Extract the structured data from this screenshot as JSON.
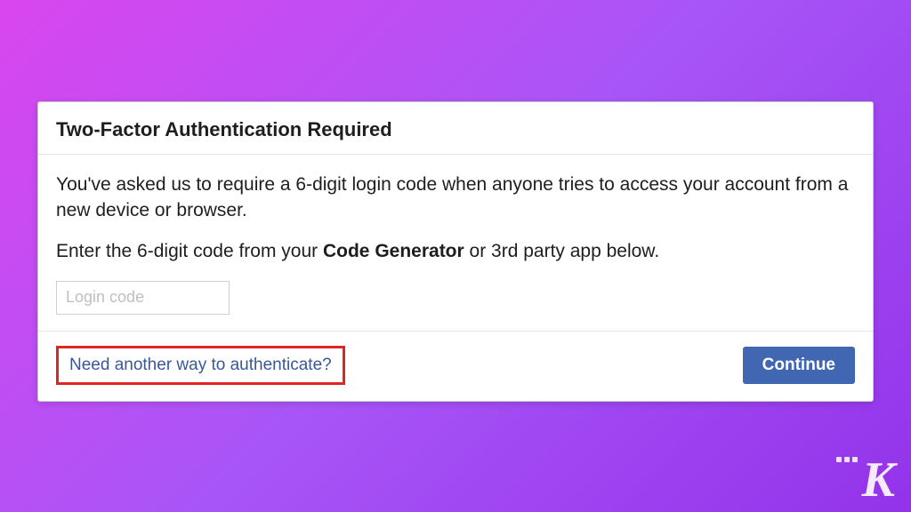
{
  "dialog": {
    "title": "Two-Factor Authentication Required",
    "description1": "You've asked us to require a 6-digit login code when anyone tries to access your account from a new device or browser.",
    "description2_prefix": "Enter the 6-digit code from your ",
    "description2_bold": "Code Generator",
    "description2_suffix": " or 3rd party app below.",
    "input_placeholder": "Login code",
    "alt_link": "Need another way to authenticate?",
    "continue_label": "Continue"
  },
  "logo": {
    "letter": "K"
  }
}
